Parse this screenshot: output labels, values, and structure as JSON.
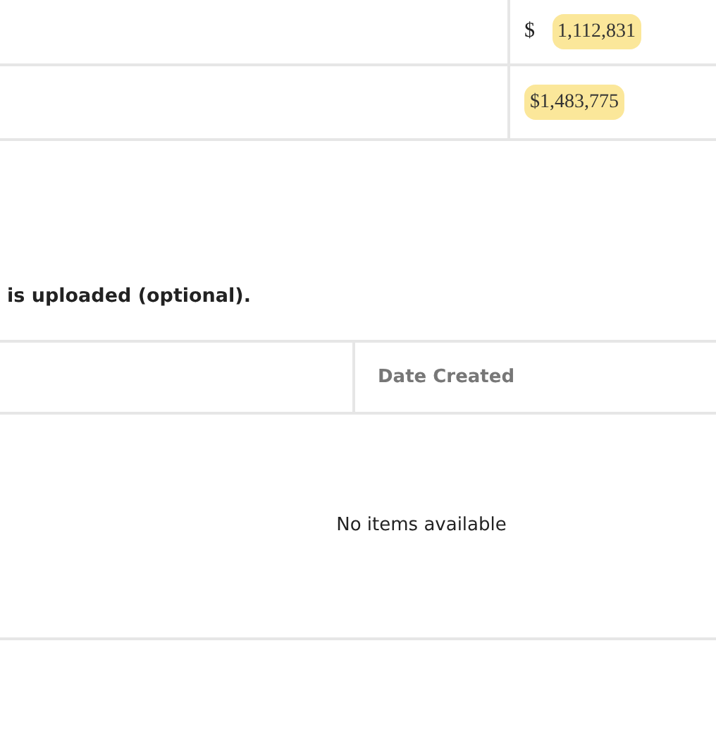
{
  "totals_table": {
    "rows": [
      {
        "currency": "$",
        "amount": "1,112,831",
        "highlighted": true
      },
      {
        "amount": "$1,483,775",
        "highlighted": true
      }
    ]
  },
  "upload_note": "is uploaded (optional).",
  "items_table": {
    "columns": [
      {},
      {
        "label": "Date Created"
      }
    ],
    "empty_message": "No items available"
  }
}
